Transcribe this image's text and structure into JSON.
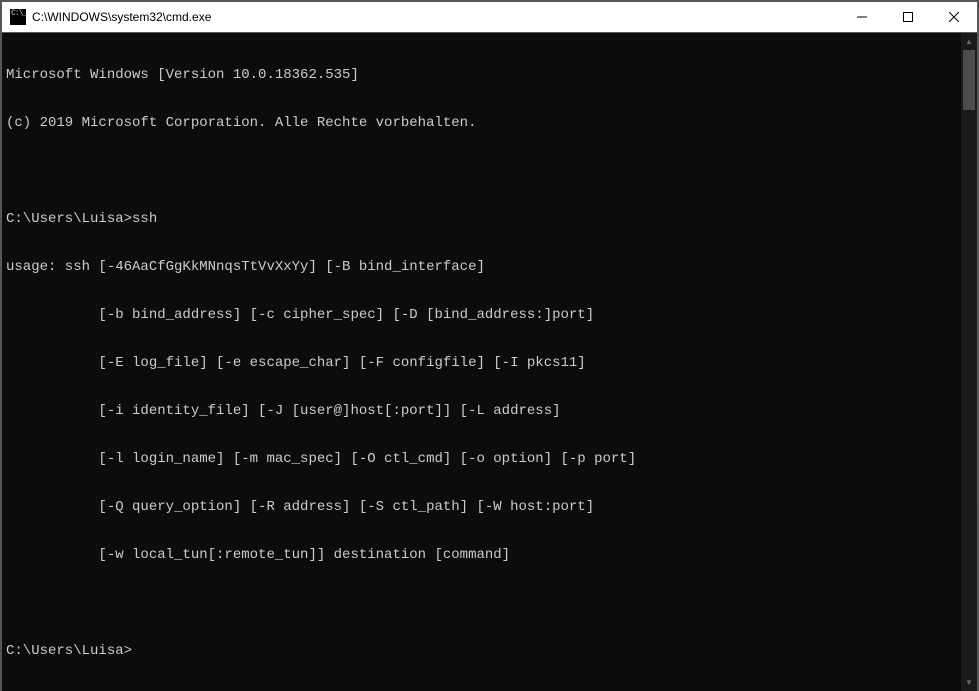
{
  "window": {
    "title": "C:\\WINDOWS\\system32\\cmd.exe"
  },
  "term": {
    "l0": "Microsoft Windows [Version 10.0.18362.535]",
    "l1": "(c) 2019 Microsoft Corporation. Alle Rechte vorbehalten.",
    "l2": "",
    "prompt1": "C:\\Users\\Luisa>",
    "cmd1": "ssh",
    "u0": "usage: ssh [-46AaCfGgKkMNnqsTtVvXxYy] [-B bind_interface]",
    "u1": "           [-b bind_address] [-c cipher_spec] [-D [bind_address:]port]",
    "u2": "           [-E log_file] [-e escape_char] [-F configfile] [-I pkcs11]",
    "u3": "           [-i identity_file] [-J [user@]host[:port]] [-L address]",
    "u4": "           [-l login_name] [-m mac_spec] [-O ctl_cmd] [-o option] [-p port]",
    "u5": "           [-Q query_option] [-R address] [-S ctl_path] [-W host:port]",
    "u6": "           [-w local_tun[:remote_tun]] destination [command]",
    "blank": "",
    "prompt2": "C:\\Users\\Luisa>"
  }
}
